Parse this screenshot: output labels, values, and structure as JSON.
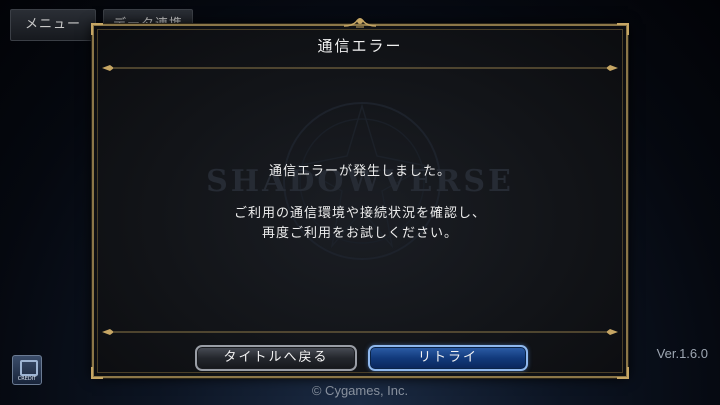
{
  "top_menu": {
    "menu_label": "メニュー",
    "link_label": "データ連携"
  },
  "background": {
    "watermark": "SHADOWVERSE",
    "icon_caption": "CREDIT"
  },
  "dialog": {
    "title": "通信エラー",
    "message_line1": "通信エラーが発生しました。",
    "message_line2": "ご利用の通信環境や接続状況を確認し、",
    "message_line3": "再度ご利用をお試しください。",
    "back_button": "タイトルへ戻る",
    "retry_button": "リトライ"
  },
  "footer": {
    "version": "Ver.1.6.0",
    "copyright": "© Cygames, Inc."
  },
  "colors": {
    "frame_gold": "#8c7748",
    "retry_blue": "#2d5ea8",
    "back_gray": "#4a4e57"
  }
}
